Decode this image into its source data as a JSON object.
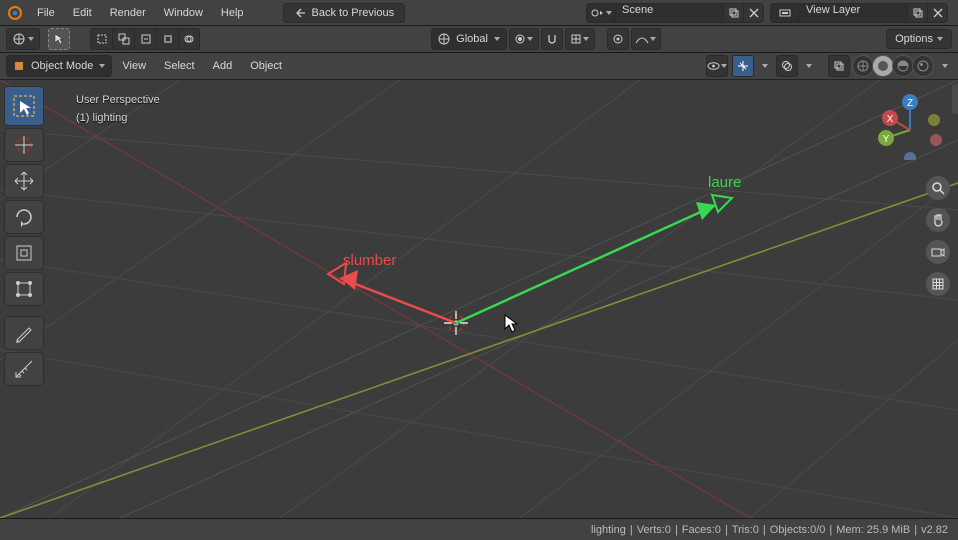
{
  "menubar": {
    "items": [
      "File",
      "Edit",
      "Render",
      "Window",
      "Help"
    ],
    "back_label": "Back to Previous",
    "scene_label": "Scene",
    "viewlayer_label": "View Layer"
  },
  "header": {
    "global_label": "Global",
    "options_label": "Options"
  },
  "viewheader": {
    "mode_label": "Object Mode",
    "menus": [
      "View",
      "Select",
      "Add",
      "Object"
    ]
  },
  "overlay": {
    "perspective": "User Perspective",
    "context": "(1) lighting"
  },
  "scene_objects": {
    "green_label": "laure",
    "red_label": "slumber"
  },
  "axis": {
    "x": "X",
    "y": "Y",
    "z": "Z"
  },
  "status": {
    "scene": "lighting",
    "verts": "Verts:0",
    "faces": "Faces:0",
    "tris": "Tris:0",
    "objects": "Objects:0/0",
    "mem": "Mem: 25.9 MiB",
    "version": "v2.82"
  },
  "colors": {
    "red": "#ed4b4b",
    "green": "#38d651",
    "blue": "#3a7ec2",
    "olive": "#8a8a3a",
    "darkred": "#6a3a3a",
    "accent": "#3a5e8c"
  }
}
